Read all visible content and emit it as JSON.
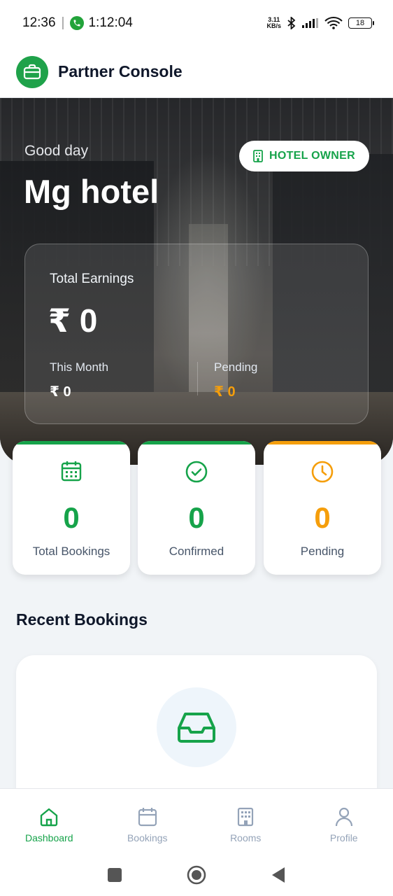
{
  "status_bar": {
    "time": "12:36",
    "separator": "|",
    "call_duration": "1:12:04",
    "speed_value": "3.11",
    "speed_unit": "KB/s",
    "battery": "18"
  },
  "header": {
    "title": "Partner Console",
    "icon": "briefcase-icon"
  },
  "hero": {
    "greeting": "Good day",
    "hotel_name": "Mg hotel",
    "role_badge": "HOTEL OWNER",
    "role_icon": "building-icon"
  },
  "earnings": {
    "label": "Total Earnings",
    "total": "₹ 0",
    "this_month_label": "This Month",
    "this_month_value": "₹ 0",
    "pending_label": "Pending",
    "pending_value": "₹ 0"
  },
  "stats": [
    {
      "label": "Total Bookings",
      "value": "0",
      "icon": "calendar-icon",
      "color": "#16a34a"
    },
    {
      "label": "Confirmed",
      "value": "0",
      "icon": "check-circle-icon",
      "color": "#16a34a"
    },
    {
      "label": "Pending",
      "value": "0",
      "icon": "clock-icon",
      "color": "#f59e0b"
    }
  ],
  "recent": {
    "title": "Recent Bookings",
    "empty_icon": "inbox-icon"
  },
  "bottom_nav": [
    {
      "label": "Dashboard",
      "icon": "home-icon",
      "active": true
    },
    {
      "label": "Bookings",
      "icon": "calendar-icon",
      "active": false
    },
    {
      "label": "Rooms",
      "icon": "building-icon",
      "active": false
    },
    {
      "label": "Profile",
      "icon": "user-icon",
      "active": false
    }
  ],
  "colors": {
    "primary": "#16a34a",
    "pending": "#f59e0b",
    "text_dark": "#0f172a",
    "muted": "#94a3b8"
  }
}
